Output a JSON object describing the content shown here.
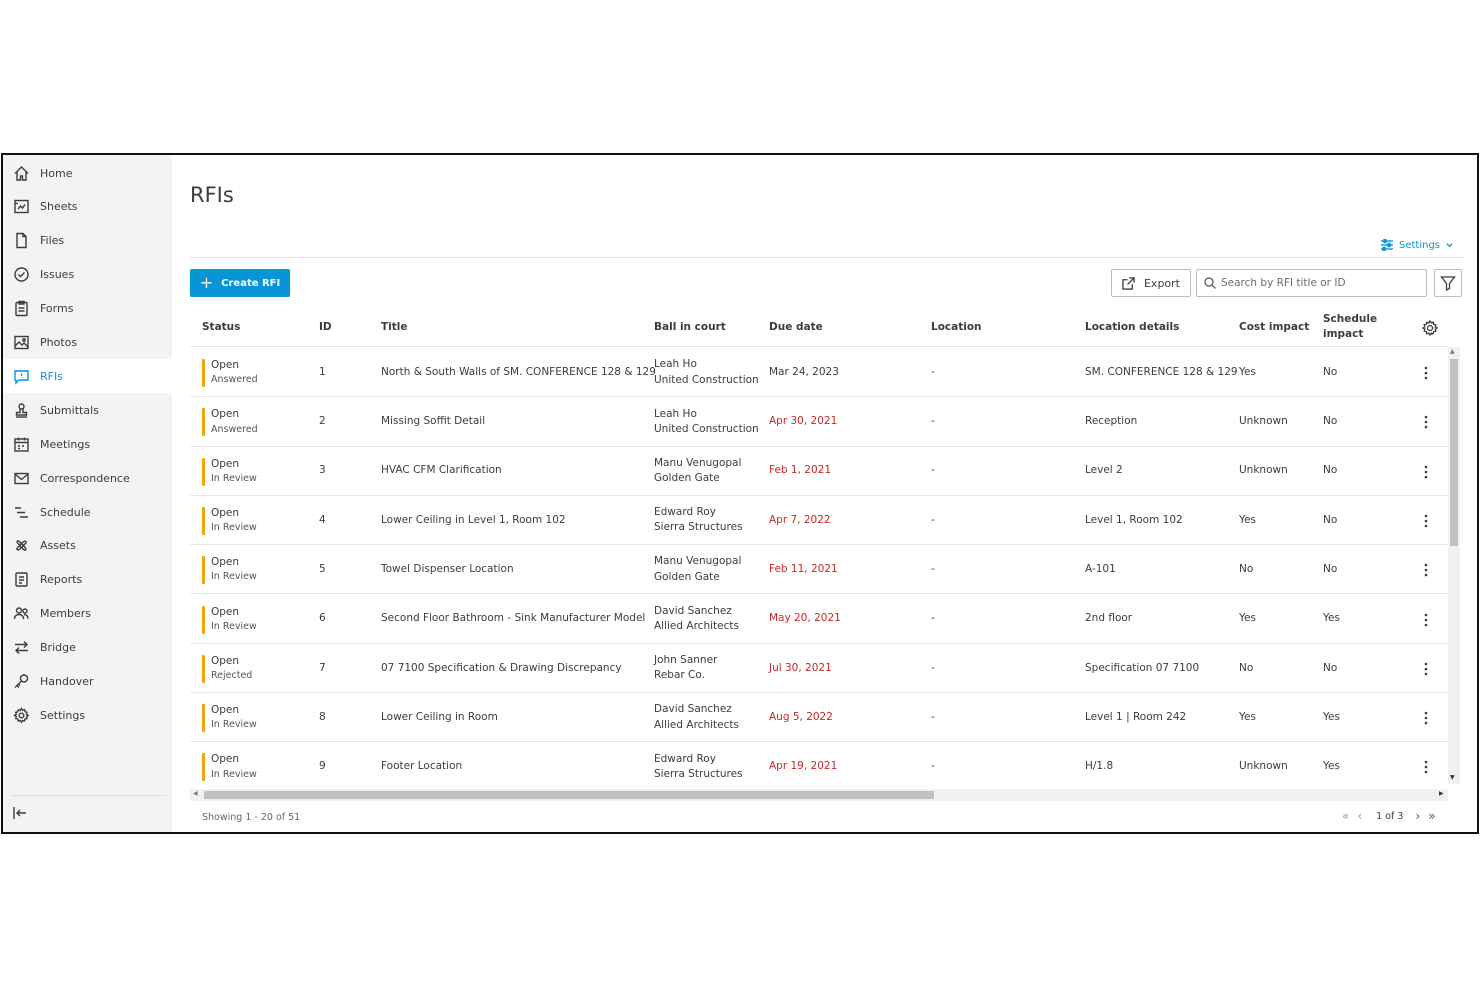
{
  "sidebar": {
    "items": [
      {
        "label": "Home",
        "icon": "home-icon"
      },
      {
        "label": "Sheets",
        "icon": "sheets-icon"
      },
      {
        "label": "Files",
        "icon": "files-icon"
      },
      {
        "label": "Issues",
        "icon": "issues-icon"
      },
      {
        "label": "Forms",
        "icon": "forms-icon"
      },
      {
        "label": "Photos",
        "icon": "photos-icon"
      },
      {
        "label": "RFIs",
        "icon": "rfis-icon",
        "active": true
      },
      {
        "label": "Submittals",
        "icon": "submittals-icon"
      },
      {
        "label": "Meetings",
        "icon": "meetings-icon"
      },
      {
        "label": "Correspondence",
        "icon": "correspondence-icon"
      },
      {
        "label": "Schedule",
        "icon": "schedule-icon"
      },
      {
        "label": "Assets",
        "icon": "assets-icon"
      },
      {
        "label": "Reports",
        "icon": "reports-icon"
      },
      {
        "label": "Members",
        "icon": "members-icon"
      },
      {
        "label": "Bridge",
        "icon": "bridge-icon"
      },
      {
        "label": "Handover",
        "icon": "handover-icon"
      },
      {
        "label": "Settings",
        "icon": "settings-icon"
      }
    ]
  },
  "page": {
    "title": "RFIs",
    "settings_label": "Settings",
    "create_label": "Create RFI",
    "export_label": "Export",
    "search_placeholder": "Search by RFI title or ID"
  },
  "table": {
    "columns": {
      "status": "Status",
      "id": "ID",
      "title": "Title",
      "ball": "Ball in court",
      "due": "Due date",
      "location": "Location",
      "location_details": "Location details",
      "cost": "Cost impact",
      "schedule": "Schedule impact"
    },
    "rows": [
      {
        "status": "Open",
        "substatus": "Answered",
        "id": "1",
        "title": "North & South Walls of SM. CONFERENCE 128 & 129",
        "ball_name": "Leah Ho",
        "ball_company": "United Construction",
        "due": "Mar 24, 2023",
        "overdue": false,
        "location": "-",
        "location_details": "SM. CONFERENCE 128 & 129",
        "cost": "Yes",
        "schedule": "No"
      },
      {
        "status": "Open",
        "substatus": "Answered",
        "id": "2",
        "title": "Missing Soffit Detail",
        "ball_name": "Leah Ho",
        "ball_company": "United Construction",
        "due": "Apr 30, 2021",
        "overdue": true,
        "location": "-",
        "location_details": "Reception",
        "cost": "Unknown",
        "schedule": "No"
      },
      {
        "status": "Open",
        "substatus": "In Review",
        "id": "3",
        "title": "HVAC CFM Clarification",
        "ball_name": "Manu Venugopal",
        "ball_company": "Golden Gate",
        "due": "Feb 1, 2021",
        "overdue": true,
        "location": "-",
        "location_details": "Level 2",
        "cost": "Unknown",
        "schedule": "No"
      },
      {
        "status": "Open",
        "substatus": "In Review",
        "id": "4",
        "title": "Lower Ceiling in Level 1, Room 102",
        "ball_name": "Edward Roy",
        "ball_company": "Sierra Structures",
        "due": "Apr 7, 2022",
        "overdue": true,
        "location": "-",
        "location_details": "Level 1, Room 102",
        "cost": "Yes",
        "schedule": "No"
      },
      {
        "status": "Open",
        "substatus": "In Review",
        "id": "5",
        "title": "Towel Dispenser Location",
        "ball_name": "Manu Venugopal",
        "ball_company": "Golden Gate",
        "due": "Feb 11, 2021",
        "overdue": true,
        "location": "-",
        "location_details": "A-101",
        "cost": "No",
        "schedule": "No"
      },
      {
        "status": "Open",
        "substatus": "In Review",
        "id": "6",
        "title": "Second Floor Bathroom - Sink Manufacturer Model",
        "ball_name": "David Sanchez",
        "ball_company": "Allied Architects",
        "due": "May 20, 2021",
        "overdue": true,
        "location": "-",
        "location_details": "2nd floor",
        "cost": "Yes",
        "schedule": "Yes"
      },
      {
        "status": "Open",
        "substatus": "Rejected",
        "id": "7",
        "title": "07 7100 Specification & Drawing Discrepancy",
        "ball_name": "John Sanner",
        "ball_company": "Rebar Co.",
        "due": "Jul 30, 2021",
        "overdue": true,
        "location": "-",
        "location_details": "Specification 07 7100",
        "cost": "No",
        "schedule": "No"
      },
      {
        "status": "Open",
        "substatus": "In Review",
        "id": "8",
        "title": "Lower Ceiling in Room",
        "ball_name": "David Sanchez",
        "ball_company": "Allied Architects",
        "due": "Aug 5, 2022",
        "overdue": true,
        "location": "-",
        "location_details": "Level 1 | Room 242",
        "cost": "Yes",
        "schedule": "Yes"
      },
      {
        "status": "Open",
        "substatus": "In Review",
        "id": "9",
        "title": "Footer Location",
        "ball_name": "Edward Roy",
        "ball_company": "Sierra Structures",
        "due": "Apr 19, 2021",
        "overdue": true,
        "location": "-",
        "location_details": "H/1.8",
        "cost": "Unknown",
        "schedule": "Yes"
      }
    ]
  },
  "footer": {
    "showing": "Showing 1 - 20 of 51",
    "page_info": "1 of 3"
  },
  "colors": {
    "accent": "#0696d7",
    "status_bar": "#f4a30b",
    "overdue": "#c62828"
  }
}
